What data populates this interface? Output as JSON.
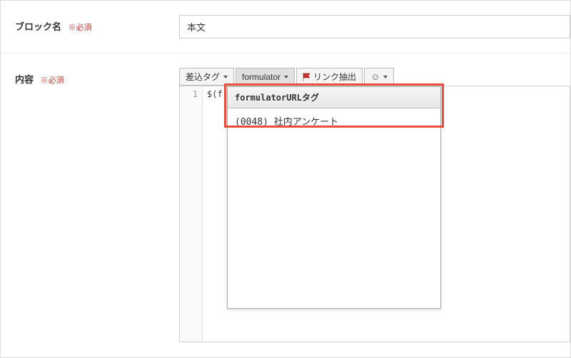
{
  "blockName": {
    "label": "ブロック名",
    "required": "※必須",
    "value": "本文"
  },
  "content": {
    "label": "内容",
    "required": "※必須"
  },
  "toolbar": {
    "insertTag": "差込タグ",
    "formulator": "formulator",
    "linkExtract": "リンク抽出"
  },
  "editor": {
    "lineNumber": "1",
    "codeText": "$(f"
  },
  "dropdown": {
    "header": "formulatorURLタグ",
    "item1": "(0048) 社内アンケート"
  }
}
